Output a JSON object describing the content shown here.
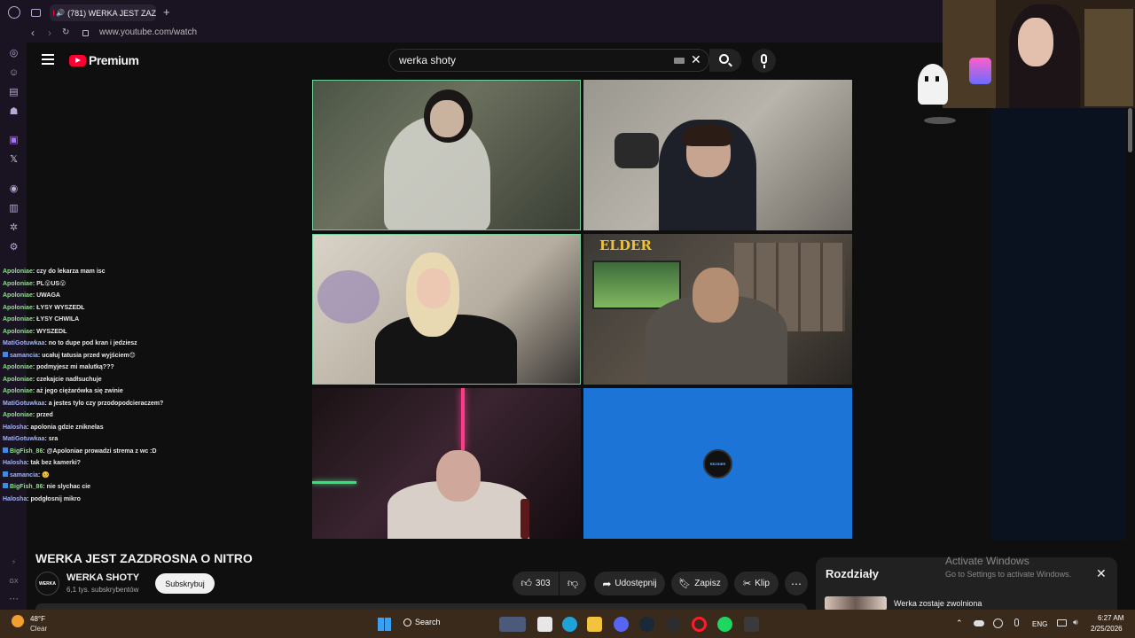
{
  "browser": {
    "tab_title": "(781) WERKA JEST ZAZ",
    "url": "www.youtube.com/watch"
  },
  "youtube": {
    "logo_text": "Premium",
    "search_value": "werka shoty"
  },
  "chat": [
    {
      "name": "Apoloniae",
      "msg": ": czy do lekarza mam isc",
      "style": "nm"
    },
    {
      "name": "Apoloniae",
      "msg": ": PL😮US😮",
      "style": "nm"
    },
    {
      "name": "Apoloniae",
      "msg": ": UWAGA",
      "style": "nm"
    },
    {
      "name": "Apoloniae",
      "msg": ": ŁYSY WYSZEDŁ",
      "style": "nm"
    },
    {
      "name": "Apoloniae",
      "msg": ": ŁYSY CHWILA",
      "style": "nm"
    },
    {
      "name": "Apoloniae",
      "msg": ": WYSZEDŁ",
      "style": "nm"
    },
    {
      "name": "MatiGotuwkaa",
      "msg": ": no to dupe pod kran i jedziesz",
      "style": "nm2"
    },
    {
      "name": "samancia",
      "msg": ": ucałuj tatusia przed wyjściem😊",
      "style": "nm2",
      "badge": true
    },
    {
      "name": "Apoloniae",
      "msg": ": podmyjesz mi malutką???",
      "style": "nm"
    },
    {
      "name": "Apoloniae",
      "msg": ": czekajcie nadłsuchuje",
      "style": "nm"
    },
    {
      "name": "Apoloniae",
      "msg": ": aż jego ciężarówka się zwinie",
      "style": "nm"
    },
    {
      "name": "MatiGotuwkaa",
      "msg": ": a jestes tylo czy przodopodcieraczem?",
      "style": "nm2"
    },
    {
      "name": "Apoloniae",
      "msg": ": przed",
      "style": "nm"
    },
    {
      "name": "Halosha",
      "msg": ": apolonia gdzie zniknelas",
      "style": "nm2"
    },
    {
      "name": "MatiGotuwkaa",
      "msg": ": sra",
      "style": "nm2"
    },
    {
      "name": "BigFish_86",
      "msg": ": @Apoloniae prowadzi strema z wc :D",
      "style": "nm",
      "badge": true
    },
    {
      "name": "Halosha",
      "msg": ": tak bez kamerki?",
      "style": "nm2"
    },
    {
      "name": "samancia",
      "msg": ": 🥺",
      "style": "nm2",
      "badge": true
    },
    {
      "name": "BigFish_86",
      "msg": ": nie slychac cie",
      "style": "nm",
      "badge": true
    },
    {
      "name": "Halosha",
      "msg": ": podgłosnij mikro",
      "style": "nm2"
    }
  ],
  "video": {
    "title": "WERKA JEST ZAZDROSNA O NITRO",
    "elder_text": "ELDER",
    "logo_text": "REZINER"
  },
  "channel": {
    "name": "WERKA SHOTY",
    "avatar_text": "WERKA",
    "subs": "6,1 tys. subskrybentów",
    "subscribe_label": "Subskrybuj"
  },
  "actions": {
    "likes": "303",
    "share": "Udostępnij",
    "save": "Zapisz",
    "clip": "Klip"
  },
  "chapters": {
    "title": "Rozdziały",
    "item": "Werka zostaje zwolniona"
  },
  "activate": {
    "line1": "Activate Windows",
    "line2": "Go to Settings to activate Windows."
  },
  "taskbar": {
    "weather_temp": "48°F",
    "weather_desc": "Clear",
    "search": "Search",
    "lang": "ENG",
    "time": "6:27 AM",
    "date": "2/25/2026"
  }
}
